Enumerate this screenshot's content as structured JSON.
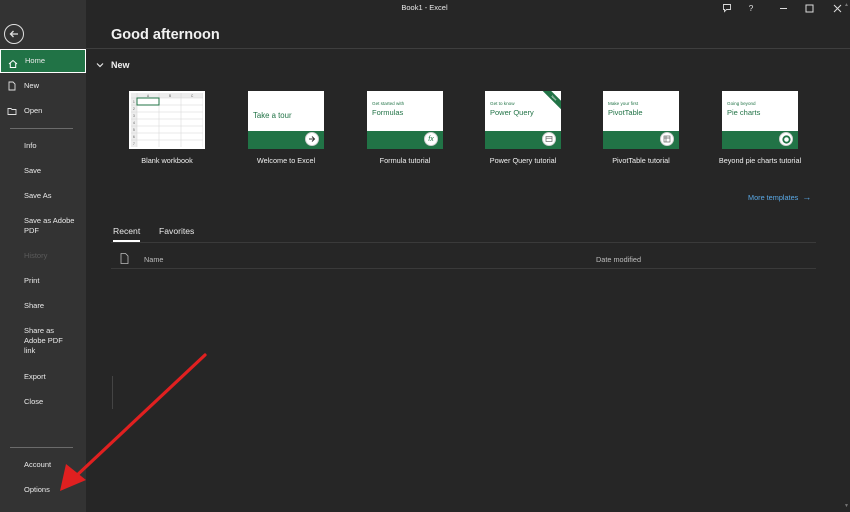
{
  "window": {
    "title": "Book1  -  Excel"
  },
  "sidebar": {
    "items": [
      {
        "label": "Home"
      },
      {
        "label": "New"
      },
      {
        "label": "Open"
      },
      {
        "label": "Info"
      },
      {
        "label": "Save"
      },
      {
        "label": "Save As"
      },
      {
        "label": "Save as Adobe\nPDF"
      },
      {
        "label": "History"
      },
      {
        "label": "Print"
      },
      {
        "label": "Share"
      },
      {
        "label": "Share as\nAdobe PDF\nlink"
      },
      {
        "label": "Export"
      },
      {
        "label": "Close"
      },
      {
        "label": "Account"
      },
      {
        "label": "Options"
      }
    ]
  },
  "main": {
    "greeting": "Good afternoon",
    "new_section": {
      "label": "New",
      "templates": [
        {
          "label": "Blank workbook"
        },
        {
          "label": "Welcome to Excel",
          "thumb_text": "Take a tour"
        },
        {
          "label": "Formula tutorial",
          "thumb_small": "Get started with",
          "thumb_big": "Formulas",
          "icon": "fx"
        },
        {
          "label": "Power Query tutorial",
          "thumb_small": "Get to know",
          "thumb_big": "Power Query",
          "ribbon": "New"
        },
        {
          "label": "PivotTable tutorial",
          "thumb_small": "Make your first",
          "thumb_big": "PivotTable"
        },
        {
          "label": "Beyond pie charts tutorial",
          "thumb_small": "Going beyond",
          "thumb_big": "Pie charts"
        }
      ],
      "more_templates": "More templates"
    },
    "tabs": [
      {
        "label": "Recent"
      },
      {
        "label": "Favorites"
      }
    ],
    "columns": {
      "name": "Name",
      "date_modified": "Date modified"
    },
    "grid": {
      "columns": [
        "A",
        "B",
        "C"
      ],
      "rows": [
        "1",
        "2",
        "3",
        "4",
        "5",
        "6",
        "7"
      ]
    }
  },
  "colors": {
    "accent": "#217346",
    "link": "#5aa9e6",
    "annotation_arrow": "#e02020"
  }
}
